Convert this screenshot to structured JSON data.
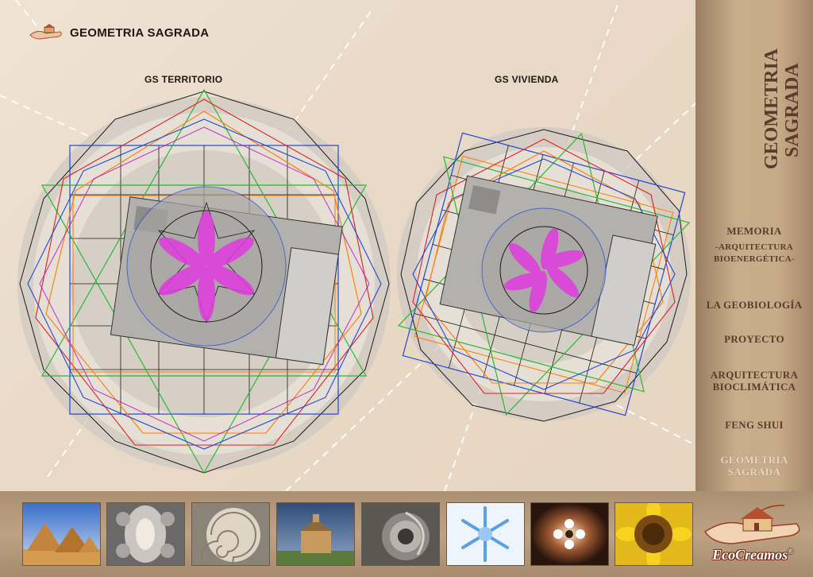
{
  "header": {
    "title": "GEOMETRIA SAGRADA",
    "logo_icon": "hand-house-logo-icon"
  },
  "sections": {
    "left_title": "GS TERRITORIO",
    "right_title": "GS VIVIENDA"
  },
  "sidebar": {
    "title_line1": "GEOMETRIA",
    "title_line2": "SAGRADA",
    "items": [
      {
        "label": "MEMORIA"
      },
      {
        "label": "-ARQUITECTURA"
      },
      {
        "label": "BIOENERGÉTICA-"
      },
      {
        "label": "LA GEOBIOLOGÍA"
      },
      {
        "label": "PROYECTO"
      },
      {
        "label": "ARQUITECTURA"
      },
      {
        "label": "BIOCLIMÁTICA"
      },
      {
        "label": "FENG SHUI"
      },
      {
        "label": "GEOMETRIA"
      },
      {
        "label": "SAGRADA"
      }
    ]
  },
  "gallery": [
    "pyramids-thumb",
    "cathedral-vault-thumb",
    "nautilus-shell-thumb",
    "chapel-thumb",
    "spiral-stair-thumb",
    "snowflake-thumb",
    "light-thumb",
    "sunflower-thumb"
  ],
  "brand": {
    "name": "EcoCreamos",
    "mark": "®"
  },
  "colors": {
    "accent": "#5b3c2c",
    "active": "#e7d8c4",
    "magenta": "#e23be0"
  }
}
